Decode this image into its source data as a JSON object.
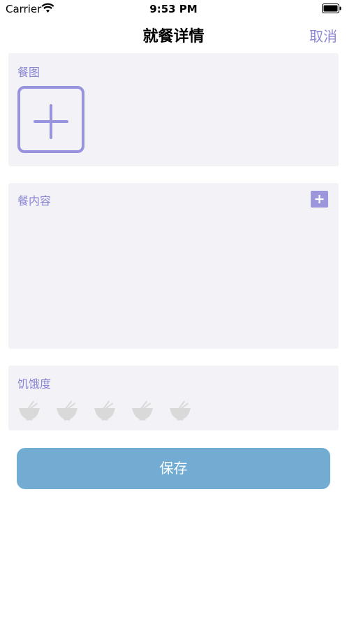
{
  "status_bar": {
    "carrier": "Carrier",
    "time": "9:53 PM",
    "icons": [
      "wifi-icon",
      "battery-icon"
    ]
  },
  "nav": {
    "title": "就餐详情",
    "cancel_label": "取消"
  },
  "photo_section": {
    "label": "餐图",
    "add_icon": "plus-icon"
  },
  "content_section": {
    "label": "餐内容",
    "add_icon": "plus-icon"
  },
  "hunger_section": {
    "label": "饥饿度",
    "level_selected": 0,
    "level_max": 5,
    "icon": "bowl-icon"
  },
  "save_label": "保存",
  "colors": {
    "accent": "#8a85d3",
    "card_background": "#f2f2f7",
    "save_button": "#72acd2",
    "bowl_inactive": "#d9d9d9"
  }
}
